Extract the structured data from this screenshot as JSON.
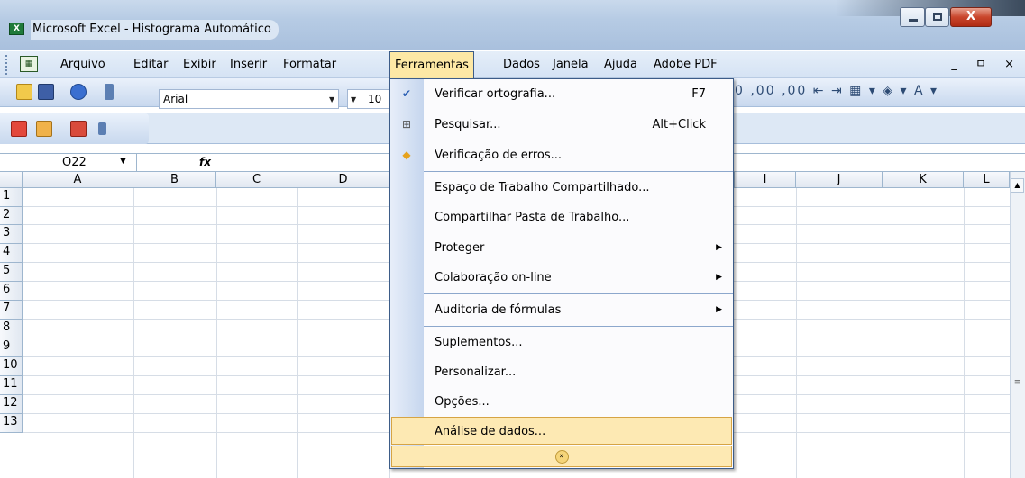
{
  "window": {
    "title": "Microsoft Excel - Histograma Automático",
    "close_label": "X"
  },
  "menubar": {
    "items": [
      "Arquivo",
      "Editar",
      "Exibir",
      "Inserir",
      "Formatar",
      "Ferramentas",
      "Dados",
      "Janela",
      "Ajuda",
      "Adobe PDF"
    ],
    "active": "Ferramentas",
    "mdi_controls": "_ ㅁ ×"
  },
  "toolbar": {
    "font_name": "Arial",
    "font_size": "10",
    "right_icons": "0  ,00  ,00  ⇤  ⇥  ▦ ▾ ◈ ▾ A ▾"
  },
  "formula_bar": {
    "name_box": "O22",
    "fx_label": "fx"
  },
  "grid": {
    "columns": [
      "A",
      "B",
      "C",
      "D",
      "I",
      "J",
      "K",
      "L"
    ],
    "rows": [
      "1",
      "2",
      "3",
      "4",
      "5",
      "6",
      "7",
      "8",
      "9",
      "10",
      "11",
      "12",
      "13"
    ]
  },
  "dropdown": {
    "items": [
      {
        "label": "Verificar ortografia...",
        "shortcut": "F7",
        "icon": "spellcheck-icon"
      },
      {
        "label": "Pesquisar...",
        "shortcut": "Alt+Click",
        "icon": "research-icon"
      },
      {
        "label": "Verificação de erros...",
        "shortcut": "",
        "icon": "error-check-icon"
      },
      {
        "label": "Espaço de Trabalho Compartilhado...",
        "shortcut": ""
      },
      {
        "label": "Compartilhar Pasta de Trabalho...",
        "shortcut": ""
      },
      {
        "label": "Proteger",
        "submenu": true
      },
      {
        "label": "Colaboração on-line",
        "submenu": true
      },
      {
        "label": "Auditoria de fórmulas",
        "submenu": true
      },
      {
        "label": "Suplementos...",
        "shortcut": ""
      },
      {
        "label": "Personalizar...",
        "shortcut": ""
      },
      {
        "label": "Opções...",
        "shortcut": ""
      },
      {
        "label": "Análise de dados...",
        "shortcut": ""
      }
    ],
    "expand_label": "»"
  },
  "colors": {
    "highlight": "#fde9b3",
    "menu_border": "#3c5c88",
    "toolbar_bg": "#d5e3f4"
  }
}
